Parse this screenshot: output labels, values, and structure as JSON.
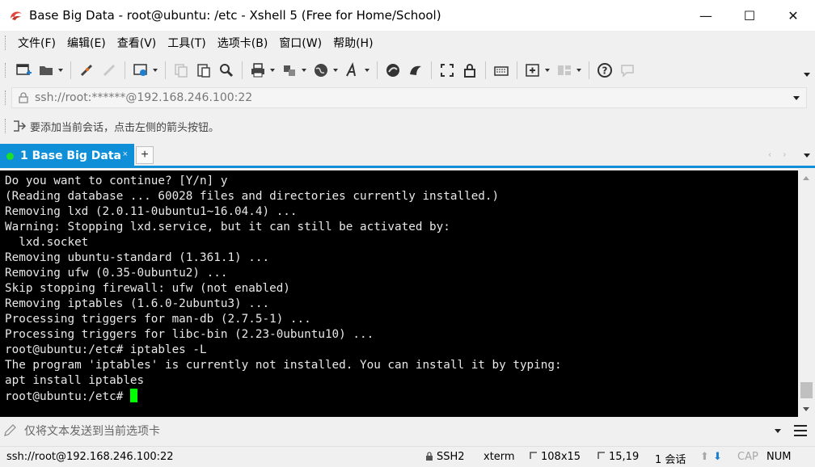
{
  "window": {
    "title": "Base Big Data - root@ubuntu: /etc - Xshell 5 (Free for Home/School)",
    "minimize": "—",
    "maximize": "☐",
    "close": "✕"
  },
  "menu": [
    "文件(F)",
    "编辑(E)",
    "查看(V)",
    "工具(T)",
    "选项卡(B)",
    "窗口(W)",
    "帮助(H)"
  ],
  "address": {
    "value": "ssh://root:******@192.168.246.100:22"
  },
  "hint": {
    "text": "要添加当前会话，点击左侧的箭头按钮。"
  },
  "tabs": [
    {
      "label": "1 Base Big Data",
      "close": "×",
      "status_color": "#1ee02a"
    }
  ],
  "tab_add": "+",
  "tab_nav": "‹ ›",
  "terminal": {
    "lines": [
      "Do you want to continue? [Y/n] y",
      "(Reading database ... 60028 files and directories currently installed.)",
      "Removing lxd (2.0.11-0ubuntu1~16.04.4) ...",
      "Warning: Stopping lxd.service, but it can still be activated by:",
      "  lxd.socket",
      "Removing ubuntu-standard (1.361.1) ...",
      "Removing ufw (0.35-0ubuntu2) ...",
      "Skip stopping firewall: ufw (not enabled)",
      "Removing iptables (1.6.0-2ubuntu3) ...",
      "Processing triggers for man-db (2.7.5-1) ...",
      "Processing triggers for libc-bin (2.23-0ubuntu10) ...",
      "root@ubuntu:/etc# iptables -L",
      "The program 'iptables' is currently not installed. You can install it by typing:",
      "apt install iptables"
    ],
    "prompt": "root@ubuntu:/etc# ",
    "cursor_color": "#00ff00"
  },
  "sendbar": {
    "text": "仅将文本发送到当前选项卡"
  },
  "status": {
    "connection": "ssh://root@192.168.246.100:22",
    "protocol": "SSH2",
    "terminal_type": "xterm",
    "size": "108x15",
    "cursor_pos": "15,19",
    "sessions": "1 会话",
    "cap": "CAP",
    "num": "NUM"
  },
  "colors": {
    "accent": "#0e8fd7",
    "terminal_bg": "#000000",
    "terminal_fg": "#e8e8e8"
  },
  "icons": {
    "toolbar": [
      "new-session-icon",
      "open-folder-icon",
      "disconnect-icon",
      "reconnect-icon",
      "properties-icon",
      "copy-icon",
      "paste-icon",
      "find-icon",
      "print-icon",
      "transfer-icon",
      "globe-icon",
      "font-icon",
      "xftp-icon",
      "xmanager-icon",
      "fullscreen-icon",
      "lock-icon",
      "keyboard-icon",
      "add-tab-icon",
      "layout-icon",
      "help-icon",
      "chat-icon"
    ]
  }
}
